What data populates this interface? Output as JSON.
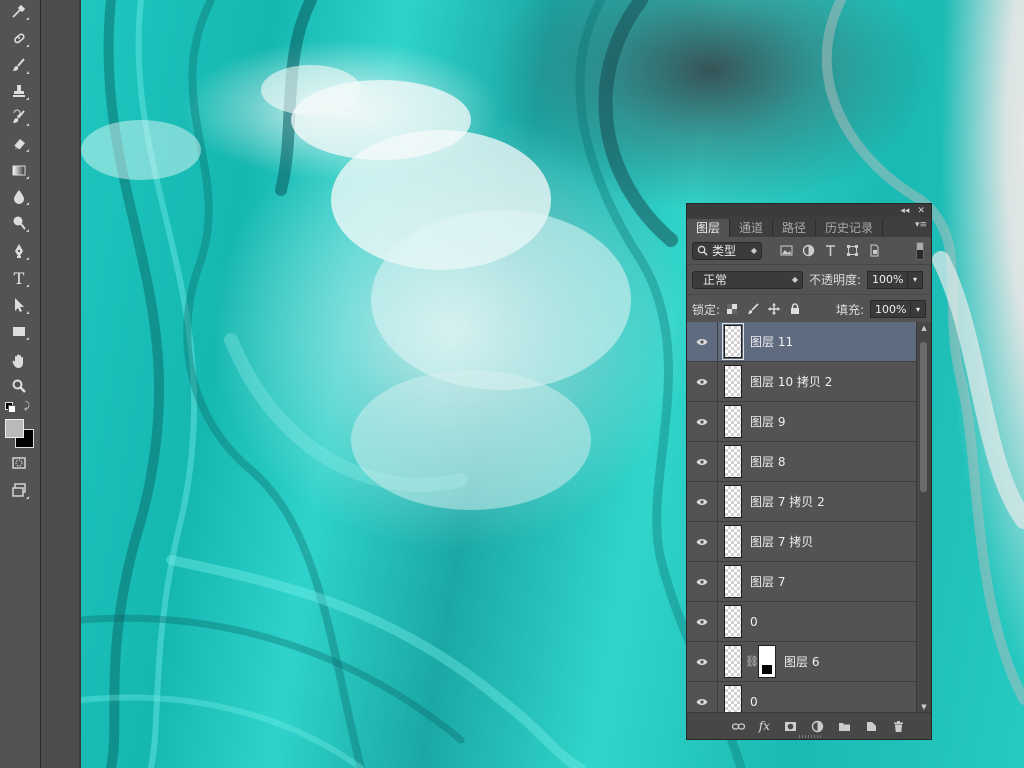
{
  "toolbar": {
    "tools": [
      {
        "name": "eyedropper-tool-icon"
      },
      {
        "name": "healing-brush-tool-icon"
      },
      {
        "name": "brush-tool-icon"
      },
      {
        "name": "clone-stamp-tool-icon"
      },
      {
        "name": "history-brush-tool-icon"
      },
      {
        "name": "eraser-tool-icon"
      },
      {
        "name": "gradient-tool-icon"
      },
      {
        "name": "blur-tool-icon"
      },
      {
        "name": "dodge-tool-icon"
      },
      {
        "name": "pen-tool-icon"
      },
      {
        "name": "type-tool-icon"
      },
      {
        "name": "path-selection-tool-icon"
      },
      {
        "name": "rectangle-tool-icon"
      },
      {
        "name": "hand-tool-icon"
      },
      {
        "name": "zoom-tool-icon"
      },
      {
        "name": "quick-mask-icon"
      },
      {
        "name": "screen-mode-icon"
      }
    ],
    "type_tool_glyph": "T",
    "foreground_color": "#b9b9b9",
    "background_color": "#000000"
  },
  "layers_panel": {
    "collapse_glyph": "◂◂",
    "close_glyph": "✕",
    "tabs": [
      {
        "label": "图层",
        "active": true
      },
      {
        "label": "通道",
        "active": false
      },
      {
        "label": "路径",
        "active": false
      },
      {
        "label": "历史记录",
        "active": false
      }
    ],
    "filter_label": "类型",
    "filter_icons": [
      "image-filter-icon",
      "adjustment-filter-icon",
      "type-filter-icon",
      "shape-filter-icon",
      "smart-object-filter-icon"
    ],
    "blend_mode": "正常",
    "opacity_label": "不透明度:",
    "opacity_value": "100%",
    "lock_label": "锁定:",
    "lock_icons": [
      "lock-transparent-icon",
      "lock-paint-icon",
      "lock-position-icon",
      "lock-all-icon"
    ],
    "fill_label": "填充:",
    "fill_value": "100%",
    "layers": [
      {
        "name": "图层 11",
        "selected": true,
        "mask": false
      },
      {
        "name": "图层 10 拷贝 2",
        "selected": false,
        "mask": false
      },
      {
        "name": "图层 9",
        "selected": false,
        "mask": false
      },
      {
        "name": "图层 8",
        "selected": false,
        "mask": false
      },
      {
        "name": "图层 7 拷贝 2",
        "selected": false,
        "mask": false
      },
      {
        "name": "图层 7 拷贝",
        "selected": false,
        "mask": false
      },
      {
        "name": "图层 7",
        "selected": false,
        "mask": false
      },
      {
        "name": "0",
        "selected": false,
        "mask": false
      },
      {
        "name": "图层 6",
        "selected": false,
        "mask": true
      },
      {
        "name": "0",
        "selected": false,
        "mask": false
      }
    ],
    "footer_fx_label": "fx",
    "footer_icons": [
      "link-layers-icon",
      "layer-style-icon",
      "add-mask-icon",
      "adjustment-layer-icon",
      "new-group-icon",
      "new-layer-icon",
      "delete-layer-icon"
    ]
  },
  "accent_colors": {
    "canvas_teal": "#1ec7bf",
    "selected_row": "#5f6c80",
    "panel_bg": "#535353"
  }
}
